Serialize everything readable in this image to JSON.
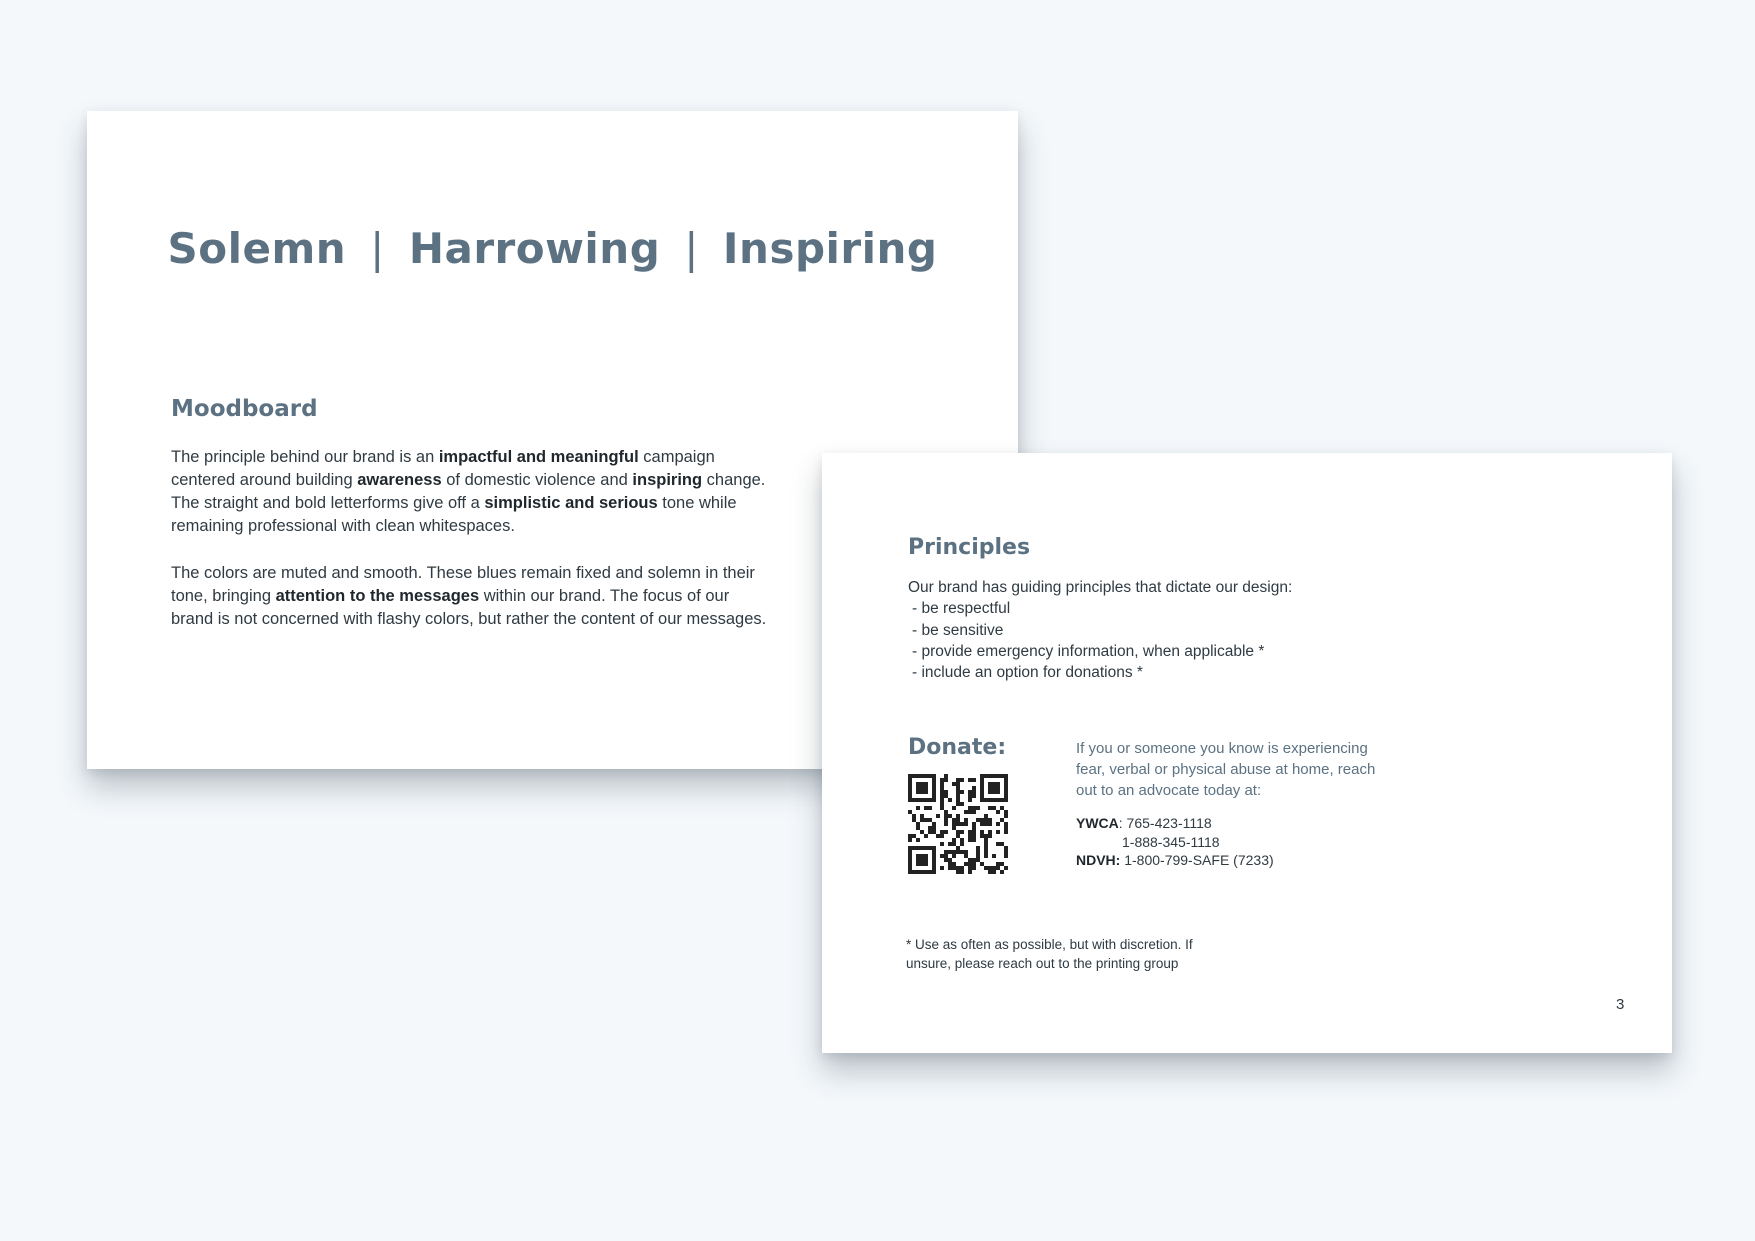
{
  "card1": {
    "tagline": [
      "Solemn",
      "Harrowing",
      "Inspiring"
    ],
    "tagline_separator": "|",
    "heading": "Moodboard",
    "paragraph1": [
      {
        "t": "The principle behind our brand is an ",
        "b": false
      },
      {
        "t": "impactful and meaningful",
        "b": true
      },
      {
        "t": " campaign centered around building ",
        "b": false
      },
      {
        "t": "awareness",
        "b": true
      },
      {
        "t": " of domestic violence and ",
        "b": false
      },
      {
        "t": "inspiring",
        "b": true
      },
      {
        "t": " change. The straight and bold letterforms give off a ",
        "b": false
      },
      {
        "t": "simplistic and serious",
        "b": true
      },
      {
        "t": " tone while remaining professional with clean whitespaces.",
        "b": false
      }
    ],
    "paragraph2": [
      {
        "t": "The colors are muted and smooth. These blues remain fixed and solemn in their tone, bringing ",
        "b": false
      },
      {
        "t": "attention to the messages",
        "b": true
      },
      {
        "t": " within our brand. The focus of our brand is not concerned with flashy colors, but rather the content of our messages.",
        "b": false
      }
    ]
  },
  "card2": {
    "heading": "Principles",
    "intro": "Our brand has guiding principles that dictate our design:",
    "principles": [
      "- be respectful",
      "- be sensitive",
      "- provide emergency information, when applicable *",
      "- include an option for donations  *"
    ],
    "donate_heading": "Donate:",
    "qr_icon": "qr-code-icon",
    "advocate_text": "If you or someone you know is experiencing fear, verbal or physical abuse at home, reach out to an advocate today at:",
    "contacts": {
      "ywca_label": "YWCA",
      "ywca_phone1": ": 765-423-1118",
      "ywca_phone2": "1-888-345-1118",
      "ndvh_label": "NDVH:",
      "ndvh_phone": " 1-800-799-SAFE (7233)"
    },
    "footnote": "* Use as often as possible, but with discretion. If unsure, please reach out to the printing group",
    "page_number": "3"
  },
  "colors": {
    "background": "#f4f8fb",
    "accent_heading": "#5c7282",
    "body_text": "#2f3a42"
  }
}
